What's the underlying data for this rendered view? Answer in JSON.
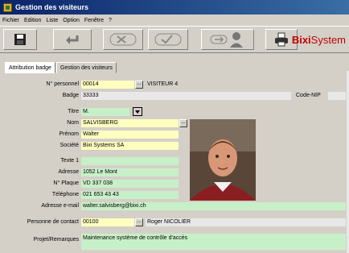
{
  "window": {
    "title": "Gestion des visiteurs"
  },
  "menu": [
    "Fichier",
    "Edition",
    "Liste",
    "Option",
    "Fenêtre",
    "?"
  ],
  "toolbar": {
    "buttons": [
      "save",
      "undo",
      "delete",
      "confirm",
      "exit",
      "print"
    ],
    "brand_bold": "Bixi",
    "brand_rest": "System"
  },
  "tabs": [
    "Attribution badge",
    "Gestion des visiteurs"
  ],
  "form": {
    "num_personnel": {
      "label": "N° personnel",
      "value": "00014",
      "name": "VISITEUR 4"
    },
    "badge": {
      "label": "Badge",
      "value": "33333"
    },
    "code_nip": {
      "label": "Code-NIP"
    },
    "titre": {
      "label": "Titre",
      "value": "M."
    },
    "nom": {
      "label": "Nom",
      "value": "SALVISBERG"
    },
    "prenom": {
      "label": "Prénom",
      "value": "Walter"
    },
    "societe": {
      "label": "Société",
      "value": "Bixi Systems SA"
    },
    "texte1": {
      "label": "Texte 1",
      "value": ""
    },
    "adresse": {
      "label": "Adresse",
      "value": "1052 Le Mont"
    },
    "plaque": {
      "label": "N° Plaque",
      "value": "VD 337 038"
    },
    "telephone": {
      "label": "Téléphone",
      "value": "021 653 43 43"
    },
    "email": {
      "label": "Adresse e-mail",
      "value": "walter.salvisberg@bixi.ch"
    },
    "contact": {
      "label": "Personne de contact",
      "value": "00100",
      "name": "Roger NICOLIER"
    },
    "projet": {
      "label": "Projet/Remarques",
      "value": "Maintenance système de contrôle d'accès"
    }
  },
  "colors": {
    "title_bar": "#0a246a",
    "required_field": "#ffffc0",
    "optional_field": "#c8f0c8",
    "brand": "#c00000"
  }
}
